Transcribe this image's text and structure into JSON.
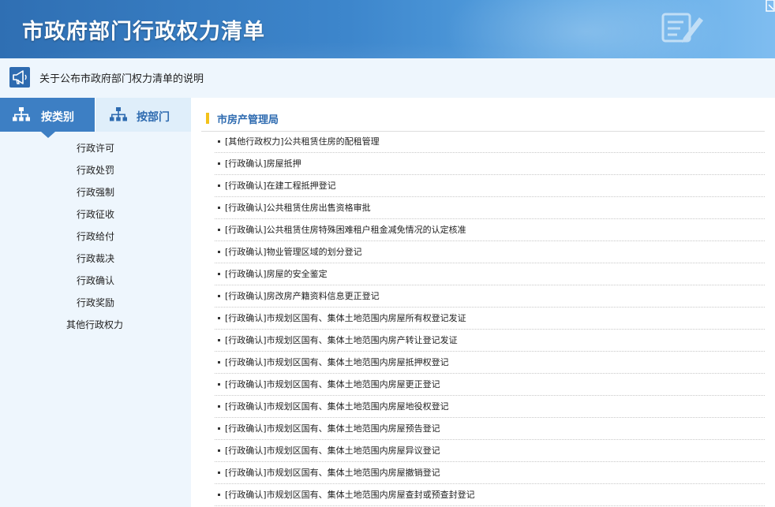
{
  "header": {
    "title": "市政府部门行政权力清单"
  },
  "notice": {
    "text": "关于公布市政府部门权力清单的说明"
  },
  "tabs": [
    {
      "label": "按类别"
    },
    {
      "label": "按部门"
    }
  ],
  "sidebar": {
    "items": [
      {
        "label": "行政许可"
      },
      {
        "label": "行政处罚"
      },
      {
        "label": "行政强制"
      },
      {
        "label": "行政征收"
      },
      {
        "label": "行政给付"
      },
      {
        "label": "行政裁决"
      },
      {
        "label": "行政确认"
      },
      {
        "label": "行政奖励"
      },
      {
        "label": "其他行政权力"
      }
    ]
  },
  "main": {
    "department": "市房产管理局",
    "items": [
      "[其他行政权力]公共租赁住房的配租管理",
      "[行政确认]房屋抵押",
      "[行政确认]在建工程抵押登记",
      "[行政确认]公共租赁住房出售资格审批",
      "[行政确认]公共租赁住房特殊困难租户租金减免情况的认定核准",
      "[行政确认]物业管理区域的划分登记",
      "[行政确认]房屋的安全鉴定",
      "[行政确认]房改房产籍资料信息更正登记",
      "[行政确认]市规划区国有、集体土地范围内房屋所有权登记发证",
      "[行政确认]市规划区国有、集体土地范围内房产转让登记发证",
      "[行政确认]市规划区国有、集体土地范围内房屋抵押权登记",
      "[行政确认]市规划区国有、集体土地范围内房屋更正登记",
      "[行政确认]市规划区国有、集体土地范围内房屋地役权登记",
      "[行政确认]市规划区国有、集体土地范围内房屋预告登记",
      "[行政确认]市规划区国有、集体土地范围内房屋异议登记",
      "[行政确认]市规划区国有、集体土地范围内房屋撤销登记",
      "[行政确认]市规划区国有、集体土地范围内房屋查封或预查封登记"
    ]
  },
  "icons": {
    "header": "edit-document-icon",
    "notice": "megaphone-icon",
    "tabs": "org-chart-icon"
  },
  "colors": {
    "header_blue": "#3d86cc",
    "tab_active": "#3d7fc4",
    "accent_yellow": "#f3c21a",
    "link_blue": "#2e6bb0",
    "panel_bg": "#eef6fd"
  }
}
